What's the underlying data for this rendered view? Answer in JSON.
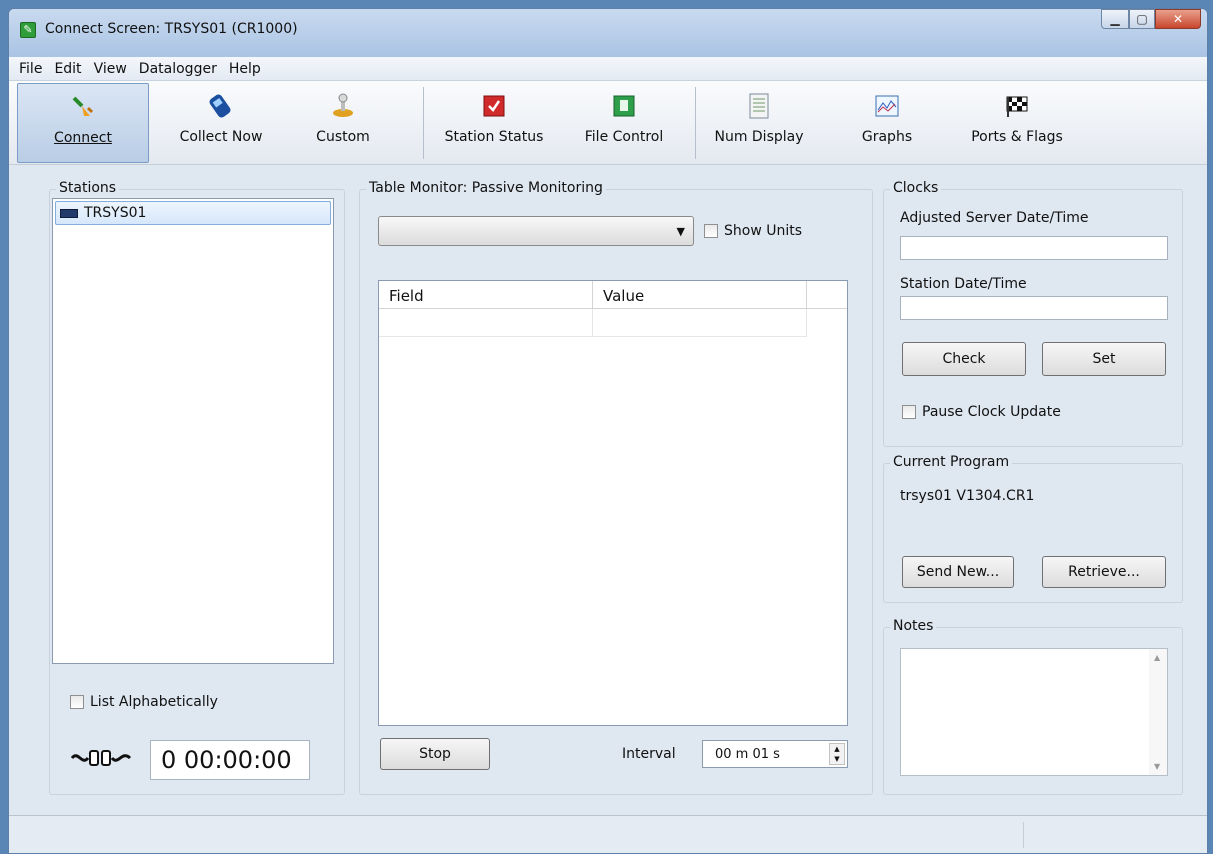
{
  "window": {
    "title": "Connect Screen: TRSYS01 (CR1000)"
  },
  "menu": [
    "File",
    "Edit",
    "View",
    "Datalogger",
    "Help"
  ],
  "toolbar": {
    "connect": "Connect",
    "collect_now": "Collect Now",
    "custom": "Custom",
    "station_status": "Station Status",
    "file_control": "File Control",
    "num_display": "Num Display",
    "graphs": "Graphs",
    "ports_flags": "Ports & Flags"
  },
  "stations": {
    "label": "Stations",
    "items": [
      "TRSYS01"
    ],
    "list_alphabetically": "List Alphabetically",
    "timer": "0 00:00:00"
  },
  "table_monitor": {
    "label": "Table Monitor: Passive Monitoring",
    "show_units": "Show Units",
    "columns": [
      "Field",
      "Value"
    ],
    "stop": "Stop",
    "interval_label": "Interval",
    "interval_value": "00 m 01 s"
  },
  "clocks": {
    "label": "Clocks",
    "server_label": "Adjusted Server Date/Time",
    "station_label": "Station Date/Time",
    "check": "Check",
    "set": "Set",
    "pause": "Pause Clock Update"
  },
  "program": {
    "label": "Current Program",
    "name": "trsys01 V1304.CR1",
    "send_new": "Send New...",
    "retrieve": "Retrieve..."
  },
  "notes": {
    "label": "Notes"
  }
}
